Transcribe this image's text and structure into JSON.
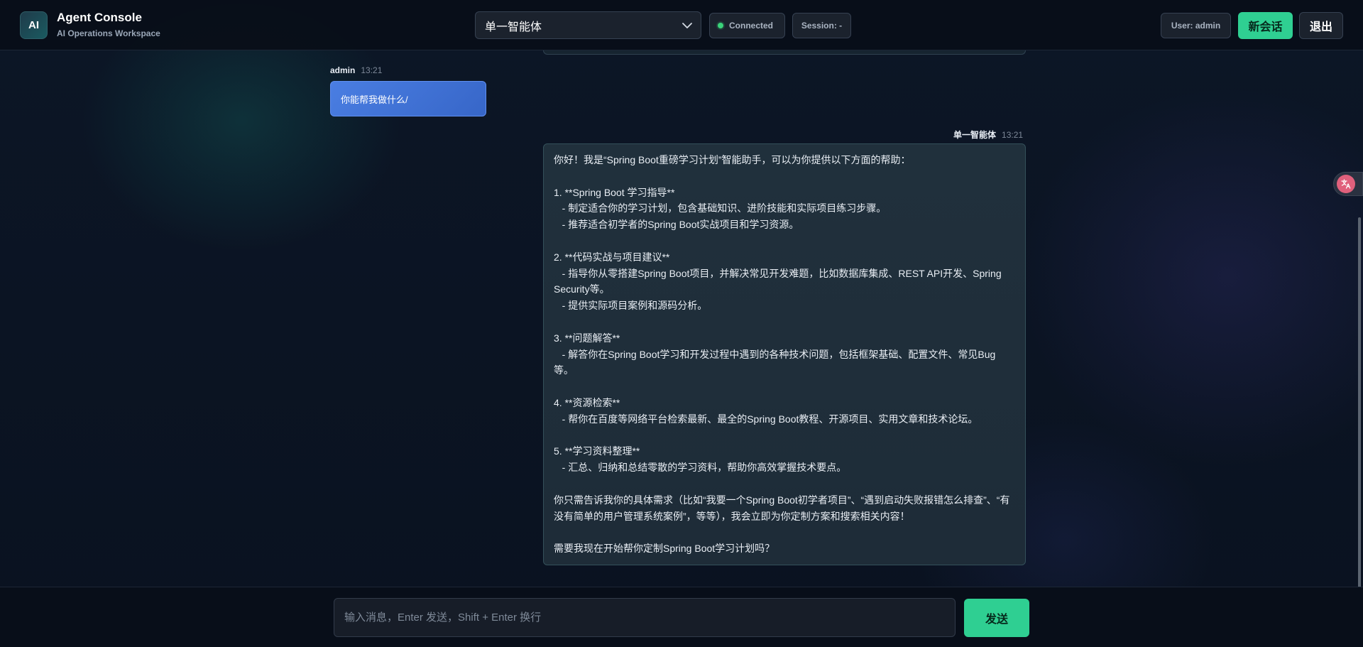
{
  "header": {
    "logo_text": "AI",
    "title": "Agent Console",
    "subtitle": "AI Operations Workspace",
    "agent_select": {
      "selected": "单一智能体"
    },
    "status": {
      "label": "Connected",
      "color": "#3ad37a"
    },
    "session_label": "Session: -",
    "user_label": "User: admin",
    "new_session_label": "新会话",
    "logout_label": "退出"
  },
  "messages": [
    {
      "sender": "admin",
      "time": "13:21",
      "text": "你能帮我做什么/"
    },
    {
      "sender": "单一智能体",
      "time": "13:21",
      "text": "你好！我是“Spring Boot重磅学习计划”智能助手，可以为你提供以下方面的帮助：\n\n1. **Spring Boot 学习指导**\n   - 制定适合你的学习计划，包含基础知识、进阶技能和实际项目练习步骤。\n   - 推荐适合初学者的Spring Boot实战项目和学习资源。\n\n2. **代码实战与项目建议**\n   - 指导你从零搭建Spring Boot项目，并解决常见开发难题，比如数据库集成、REST API开发、Spring Security等。\n   - 提供实际项目案例和源码分析。\n\n3. **问题解答**\n   - 解答你在Spring Boot学习和开发过程中遇到的各种技术问题，包括框架基础、配置文件、常见Bug等。\n\n4. **资源检索**\n   - 帮你在百度等网络平台检索最新、最全的Spring Boot教程、开源项目、实用文章和技术论坛。\n\n5. **学习资料整理**\n   - 汇总、归纳和总结零散的学习资料，帮助你高效掌握技术要点。\n\n你只需告诉我你的具体需求（比如“我要一个Spring Boot初学者项目”、“遇到启动失败报错怎么排查”、“有没有简单的用户管理系统案例”，等等），我会立即为你定制方案和搜索相关内容！\n\n需要我现在开始帮你定制Spring Boot学习计划吗？"
    }
  ],
  "composer": {
    "placeholder": "输入消息，Enter 发送，Shift + Enter 换行",
    "value": "",
    "send_label": "发送"
  },
  "icons": {
    "logo": "ai-logo-icon",
    "select_chevron": "chevron-down-icon",
    "status_dot": "status-dot-icon",
    "translate": "translate-icon"
  },
  "colors": {
    "accent": "#2fcf92",
    "user_bubble": "#3f72d6",
    "bot_bubble": "#1f2f3b",
    "background": "#0a1220"
  }
}
